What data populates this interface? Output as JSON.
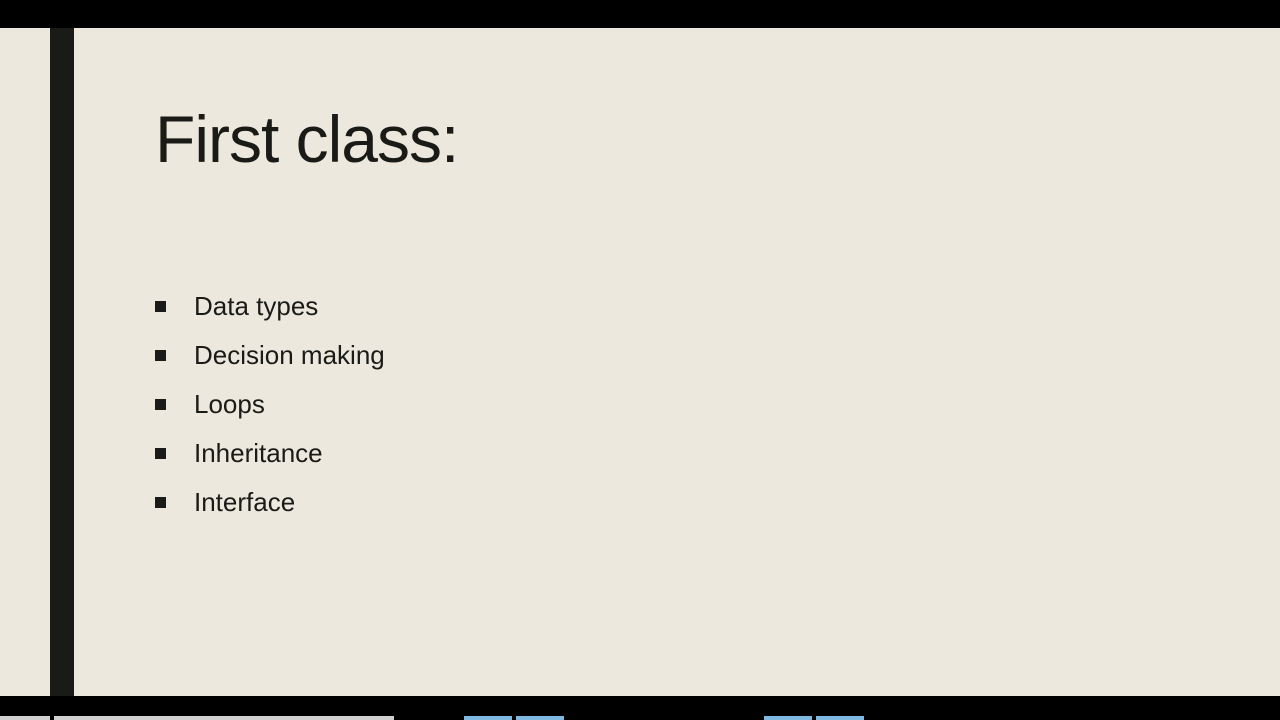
{
  "slide": {
    "title": "First class:",
    "bullets": [
      "Data types",
      "Decision making",
      "Loops",
      "Inheritance",
      "Interface"
    ]
  }
}
